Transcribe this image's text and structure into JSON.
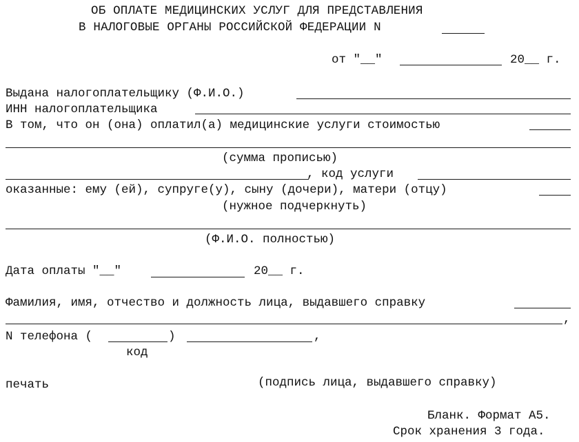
{
  "document": {
    "title_line1": "ОБ ОПЛАТЕ МЕДИЦИНСКИХ УСЛУГ ДЛЯ ПРЕДСТАВЛЕНИЯ",
    "title_line2": "В НАЛОГОВЫЕ ОРГАНЫ РОССИЙСКОЙ ФЕДЕРАЦИИ N",
    "date_line": {
      "prefix": "от \"__\"",
      "year": "20__ г."
    },
    "issued_to_label": "Выдана налогоплательщику (Ф.И.О.)",
    "inn_label": "ИНН налогоплательщика",
    "payment_statement": "В том, что он (она) оплатил(а) медицинские услуги стоимостью",
    "amount_in_words_hint": "(сумма прописью)",
    "service_code_label": ", код услуги",
    "provided_to_label": "оказанные: ему (ей), супруге(у), сыну (дочери), матери (отцу)",
    "underline_hint": "(нужное подчеркнуть)",
    "full_name_hint": "(Ф.И.О. полностью)",
    "payment_date": {
      "prefix": "Дата оплаты \"__\"",
      "year": "20__ г."
    },
    "issuer_label": "Фамилия, имя, отчество и должность лица, выдавшего справку",
    "issuer_line_comma": ",",
    "phone": {
      "label": "N телефона (",
      "close_paren": ")",
      "comma": ",",
      "code_hint": "код"
    },
    "stamp_label": "печать",
    "signature_hint": "(подпись лица, выдавшего справку)",
    "footer_line1": "Бланк. Формат А5.",
    "footer_line2": "Срок хранения 3 года."
  }
}
